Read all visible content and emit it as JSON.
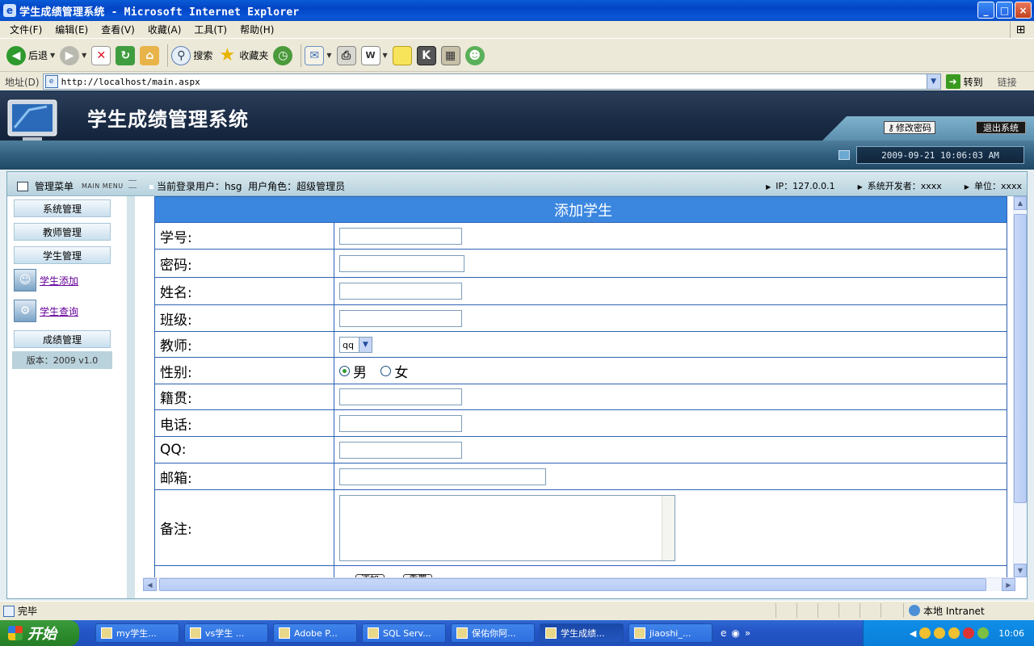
{
  "window": {
    "title": "学生成绩管理系统 - Microsoft Internet Explorer",
    "controls": [
      "_",
      "□",
      "×"
    ]
  },
  "menubar": [
    "文件(F)",
    "编辑(E)",
    "查看(V)",
    "收藏(A)",
    "工具(T)",
    "帮助(H)"
  ],
  "toolbar": {
    "back": "后退",
    "search": "搜索",
    "favorites": "收藏夹"
  },
  "address": {
    "label": "地址(D)",
    "url": "http://localhost/main.aspx",
    "go": "转到",
    "links": "链接"
  },
  "banner": {
    "title": "学生成绩管理系统",
    "change_password": "修改密码",
    "logout": "退出系统",
    "datetime": "2009-09-21 10:06:03 AM"
  },
  "userbar": {
    "menu_title": "管理菜单",
    "menu_title_en": "MAIN MENU",
    "current_user": "当前登录用户：hsg",
    "role": "用户角色：超级管理员",
    "ip": "IP：127.0.0.1",
    "developer": "系统开发者：xxxx",
    "unit": "单位：xxxx"
  },
  "leftmenu": {
    "system": "系统管理",
    "teacher": "教师管理",
    "student": "学生管理",
    "add_student": "学生添加",
    "query_student": "学生查询",
    "grades": "成绩管理",
    "version": "版本：2009 v1.0"
  },
  "form": {
    "title": "添加学生",
    "labels": {
      "id": "学号:",
      "password": "密码:",
      "name": "姓名:",
      "class": "班级:",
      "teacher": "教师:",
      "gender": "性别:",
      "hometown": "籍贯:",
      "phone": "电话:",
      "qq": "QQ:",
      "email": "邮箱:",
      "remark": "备注:"
    },
    "teacher_selected": "qq",
    "gender_options": [
      "男",
      "女"
    ],
    "gender_selected": "男",
    "add_button": "添加",
    "reset_button": "重置"
  },
  "status": {
    "text": "完毕",
    "zone": "本地 Intranet"
  },
  "taskbar": {
    "start": "开始",
    "tasks": [
      "my学生...",
      "vs学生 ...",
      "Adobe P...",
      "SQL Serv...",
      "保佑你阿...",
      "学生成绩...",
      "jiaoshi_..."
    ],
    "clock": "10:06"
  }
}
